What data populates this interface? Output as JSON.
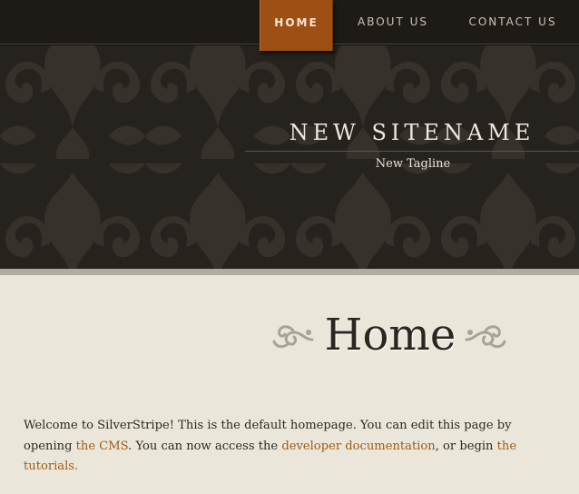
{
  "nav": {
    "items": [
      {
        "label": "HOME",
        "active": true
      },
      {
        "label": "ABOUT US",
        "active": false
      },
      {
        "label": "CONTACT US",
        "active": false
      }
    ]
  },
  "header": {
    "site_name": "NEW SITENAME",
    "tagline": "New Tagline"
  },
  "main": {
    "title": "Home",
    "intro": {
      "text_1": "Welcome to SilverStripe! This is the default homepage. You can edit this page by opening ",
      "link_cms": "the CMS",
      "text_2": ". You can now access the ",
      "link_docs": "developer documentation",
      "text_3": ", or begin ",
      "link_tutorials": "the tutorials.",
      "text_4": ""
    }
  },
  "colors": {
    "header_bg": "#26231e",
    "nav_active_bg": "#9e4f14",
    "content_bg": "#ebe6da",
    "link": "#a05a14"
  },
  "icons": {
    "flourish_left": "flourish-icon",
    "flourish_right": "flourish-icon"
  }
}
